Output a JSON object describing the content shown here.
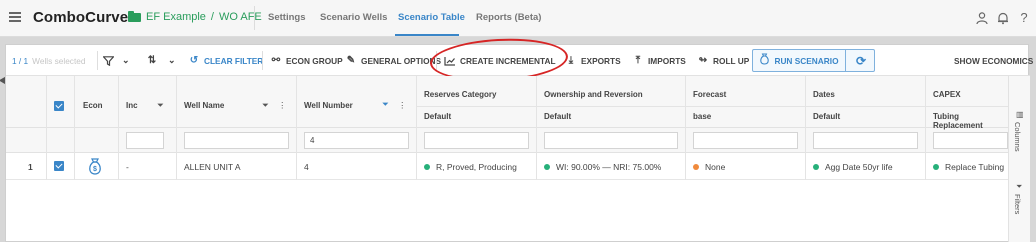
{
  "app": {
    "logo": "ComboCurve",
    "project": "EF Example",
    "project_sep": "/",
    "scenario": "WO AFE"
  },
  "nav": {
    "tabs": [
      {
        "label": "Settings",
        "active": false
      },
      {
        "label": "Scenario Wells",
        "active": false
      },
      {
        "label": "Scenario Table",
        "active": true
      },
      {
        "label": "Reports (Beta)",
        "active": false
      }
    ],
    "right_icons": [
      "user-icon",
      "bell-icon",
      "help-icon"
    ]
  },
  "toolbar": {
    "well_count": "1 / 1",
    "wells_selected": "Wells selected",
    "clear_filter": "CLEAR FILTER",
    "econ_group": "ECON GROUP",
    "general_options": "GENERAL OPTIONS",
    "create_incremental": "CREATE INCREMENTAL",
    "exports": "EXPORTS",
    "imports": "IMPORTS",
    "roll_up": "ROLL UP",
    "run_scenario": "RUN SCENARIO",
    "show_economics": "SHOW ECONOMICS"
  },
  "grid": {
    "columns": {
      "econ": "Econ",
      "inc": "Inc",
      "well_name": "Well Name",
      "well_number": "Well Number",
      "reserves_category": "Reserves Category",
      "ownership": "Ownership and Reversion",
      "forecast": "Forecast",
      "dates": "Dates",
      "capex": "CAPEX"
    },
    "subheaders": {
      "reserves_category": "Default",
      "ownership": "Default",
      "forecast": "base",
      "dates": "Default",
      "capex": "Tubing Replacement"
    },
    "filters": {
      "well_number": "4"
    },
    "rows": [
      {
        "index": "1",
        "inc": "-",
        "well_name": "ALLEN UNIT A",
        "well_number": "4",
        "reserves_category": "R, Proved, Producing",
        "ownership": "WI: 90.00% — NRI: 75.00%",
        "forecast": "None",
        "dates": "Agg Date 50yr life",
        "capex": "Replace Tubing"
      }
    ]
  },
  "side_panel": {
    "columns": "Columns",
    "filters": "Filters"
  },
  "colors": {
    "accent": "#3a86c8",
    "brand_green": "#2a9d5c",
    "status_green": "#27b07a",
    "status_orange": "#f08a3c",
    "highlight_red": "#d62525"
  }
}
